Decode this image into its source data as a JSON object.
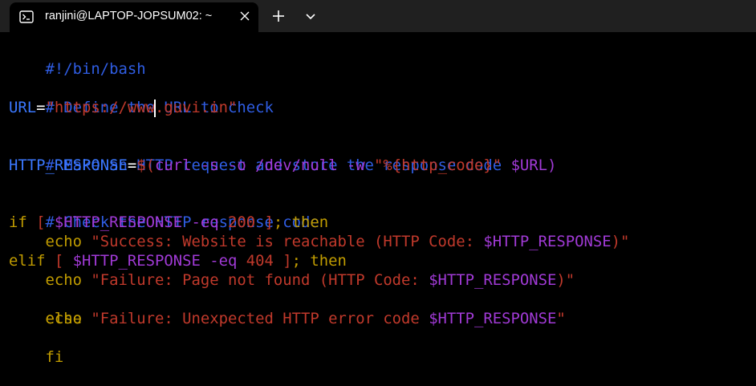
{
  "window": {
    "tab_title": "ranjini@LAPTOP-JOPSUM02: ~",
    "icons": {
      "tab": "terminal-icon",
      "close": "close-icon",
      "new_tab": "plus-icon",
      "dropdown": "chevron-down-icon"
    }
  },
  "colors": {
    "background": "#000000",
    "titlebar": "#202020",
    "comment": "#2f5de3",
    "variable": "#3b78ff",
    "string": "#c0392b",
    "string_variable": "#a13ad6",
    "keyword": "#c19c00"
  },
  "script": {
    "line1": {
      "text": "#!/bin/bash"
    },
    "line3": {
      "text": "# Define the URL to check"
    },
    "line4": {
      "var": "URL",
      "op": "=",
      "str_before_cursor": "\"https://www",
      "str_after_cursor": ".guvi.in\""
    },
    "line6": {
      "text": "# Make an HTTP request and store the response code"
    },
    "line7": {
      "var": "HTTP_RESPONSE",
      "op": "=",
      "subst_open": "$(",
      "cmd": "curl -s -o /dev/null -w ",
      "fmt": "\"%{http_code}\"",
      "space": " ",
      "arg": "$URL",
      "subst_close": ")"
    },
    "line9": {
      "text": "# Check the HTTP response code"
    },
    "line10": {
      "kw_if": "if",
      "bracket_open": " [ ",
      "var": "$HTTP_RESPONSE",
      "test": " -eq ",
      "num": "200",
      "bracket_close": " ]",
      "semi": ";",
      "kw_then": " then"
    },
    "line11": {
      "indent": "    ",
      "cmd": "echo",
      "str": " \"Success: Website is reachable (HTTP Code: ",
      "var": "$HTTP_RESPONSE",
      "str_end": ")\""
    },
    "line12": {
      "kw_elif": "elif",
      "bracket_open": " [ ",
      "var": "$HTTP_RESPONSE",
      "test": " -eq ",
      "num": "404",
      "bracket_close": " ]",
      "semi": ";",
      "kw_then": " then"
    },
    "line13": {
      "indent": "    ",
      "cmd": "echo",
      "str": " \"Failure: Page not found (HTTP Code: ",
      "var": "$HTTP_RESPONSE",
      "str_end": ")\""
    },
    "line14": {
      "text": "else"
    },
    "line15": {
      "indent": "    ",
      "cmd": "echo",
      "str": " \"Failure: Unexpected HTTP error code ",
      "var": "$HTTP_RESPONSE",
      "str_end": "\""
    },
    "line16": {
      "text": "fi"
    }
  }
}
